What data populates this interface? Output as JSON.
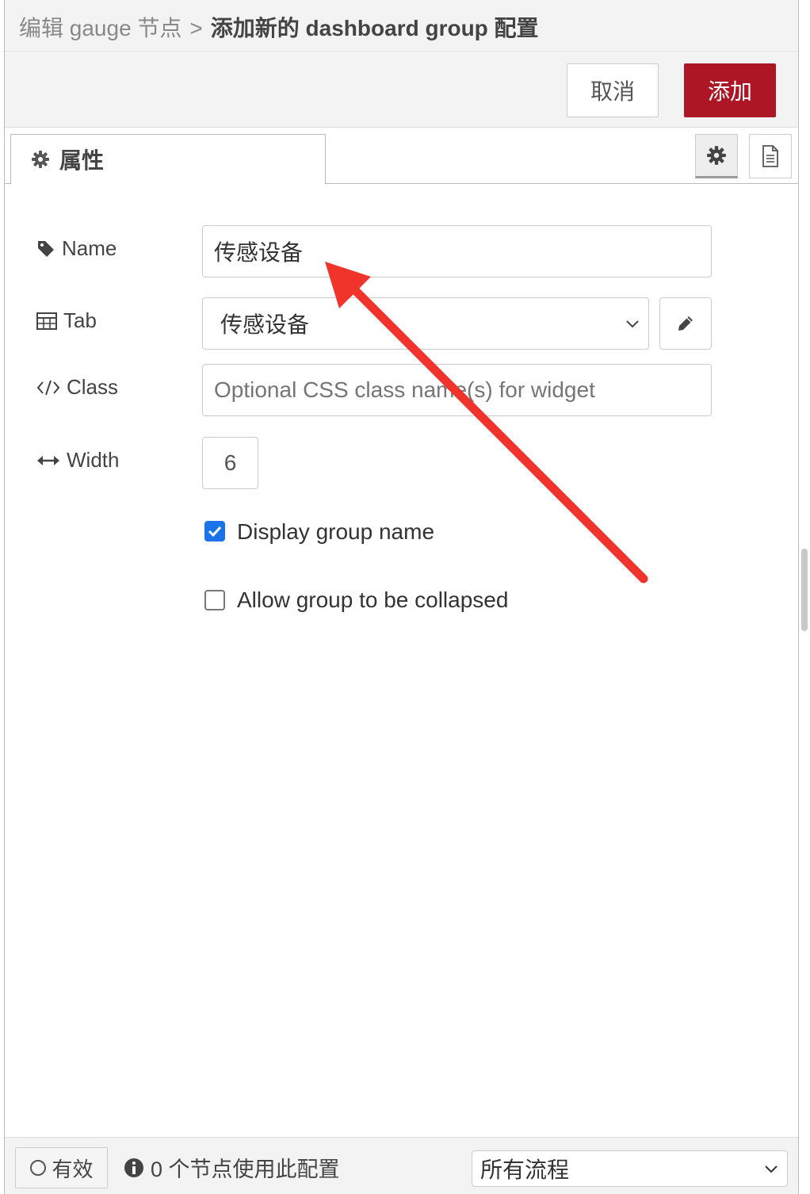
{
  "breadcrumb": {
    "previous": "编辑 gauge 节点",
    "separator": ">",
    "current": "添加新的 dashboard group 配置"
  },
  "toolbar": {
    "cancel_label": "取消",
    "add_label": "添加",
    "add_color": "#ad1625"
  },
  "tabs": {
    "properties_label": "属性",
    "properties_icon": "gear-icon",
    "settings_icon": "gear-icon",
    "description_icon": "document-icon"
  },
  "form": {
    "name": {
      "label": "Name",
      "icon": "tag-icon",
      "value": "传感设备"
    },
    "tab": {
      "label": "Tab",
      "icon": "table-icon",
      "selected": "传感设备",
      "edit_icon": "pencil-icon"
    },
    "class": {
      "label": "Class",
      "icon": "code-icon",
      "value": "",
      "placeholder": "Optional CSS class name(s) for widget"
    },
    "width": {
      "label": "Width",
      "icon": "arrows-h-icon",
      "value": "6"
    },
    "display_group_name": {
      "label": "Display group name",
      "checked": true
    },
    "allow_collapse": {
      "label": "Allow group to be collapsed",
      "checked": false
    }
  },
  "footer": {
    "valid_label": "有效",
    "usage_text": "0 个节点使用此配置",
    "scope_selected": "所有流程"
  },
  "annotation": {
    "type": "arrow",
    "color": "#f0332b"
  }
}
